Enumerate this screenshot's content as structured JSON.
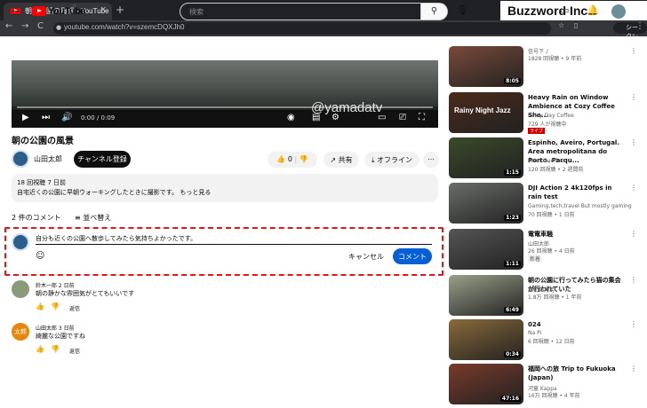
{
  "browser": {
    "tab_title": "朝の公園の風景 - YouTube",
    "tab_close": "×",
    "new_tab": "+",
    "url": "youtube.com/watch?v=szemcDQXJh0",
    "incognito_label": "シークレット",
    "back": "←",
    "forward": "→",
    "reload": "C"
  },
  "brand": "Buzzword Inc.",
  "yt": {
    "logo_text": "YouTube",
    "logo_sup": "JP",
    "search_placeholder": "検索"
  },
  "player": {
    "time": "0:00 / 0:09",
    "watermark": "@yamadatv"
  },
  "video": {
    "title": "朝の公園の風景",
    "channel": "山田太郎",
    "subscribe": "チャンネル登録",
    "likes": "0",
    "share": "共有",
    "offline": "オフライン",
    "description_meta": "18 回視聴  7 日前",
    "description": "自宅近くの公園に早朝ウォーキングしたときに撮影です。 もっと見る"
  },
  "comments": {
    "count": "2 件のコメント",
    "sort": "並べ替え",
    "draft": "自分も近くの公園へ散歩してみたら気持ちよかったです。",
    "cancel": "キャンセル",
    "submit": "コメント",
    "items": [
      {
        "author": "鈴木一郎  2 日前",
        "text": "朝の静かな雰囲気がとてもいいです",
        "reply": "返信",
        "avatar_color": "#8a9a7a"
      },
      {
        "author": "山田太郎  3 日前",
        "text": "綺麗な公園ですね",
        "reply": "返信",
        "avatar_text": "太郎",
        "avatar_color": "#e8850c"
      }
    ]
  },
  "sidebar": [
    {
      "title": "",
      "channel": "信号下 ♪",
      "meta": "1828 回視聴 • 9 年前",
      "duration": "8:05",
      "color": "#7a4a3a"
    },
    {
      "title": "Heavy Rain on Window Ambience at Cozy Coffee Sho...",
      "channel": "Rainy Day Coffee",
      "meta": "729 人が視聴中",
      "live": "ライブ",
      "thumb_text": "Rainy Night Jazz",
      "color": "#4a2a1a"
    },
    {
      "title": "Espinho, Aveiro, Portugal. Área metropolitana do Porto. Parqu...",
      "channel": "Artur Guedes",
      "meta": "120 回視聴 • 2 週間前",
      "duration": "1:15",
      "color": "#3a4a2a"
    },
    {
      "title": "DJI Action 2 4k120fps in rain test",
      "channel": "Gaming,tech,travel But mostly gaming",
      "meta": "70 回視聴 • 1 日前",
      "duration": "1:23",
      "color": "#6a6e6a"
    },
    {
      "title": "電電車騒",
      "channel": "山田太郎",
      "meta": "26 回視聴 • 4 日前",
      "meta2": "新着",
      "duration": "1:11",
      "color": "#555"
    },
    {
      "title": "朝の公園に行ってみたら猫の集会が行われていた",
      "channel": "猫動画専用",
      "meta": "1.8万 回視聴 • 1 年前",
      "duration": "6:49",
      "color": "#9aa08a"
    },
    {
      "title": "024",
      "channel": "Na Pi",
      "meta": "6 回視聴 • 12 日前",
      "duration": "0:34",
      "color": "#8a6a3a"
    },
    {
      "title": "福岡への旅 Trip to Fukuoka (Japan)",
      "channel": "河童 Kappa",
      "meta": "16万 回視聴 • 4 年前",
      "duration": "47:16",
      "color": "#7a3a2a"
    }
  ]
}
